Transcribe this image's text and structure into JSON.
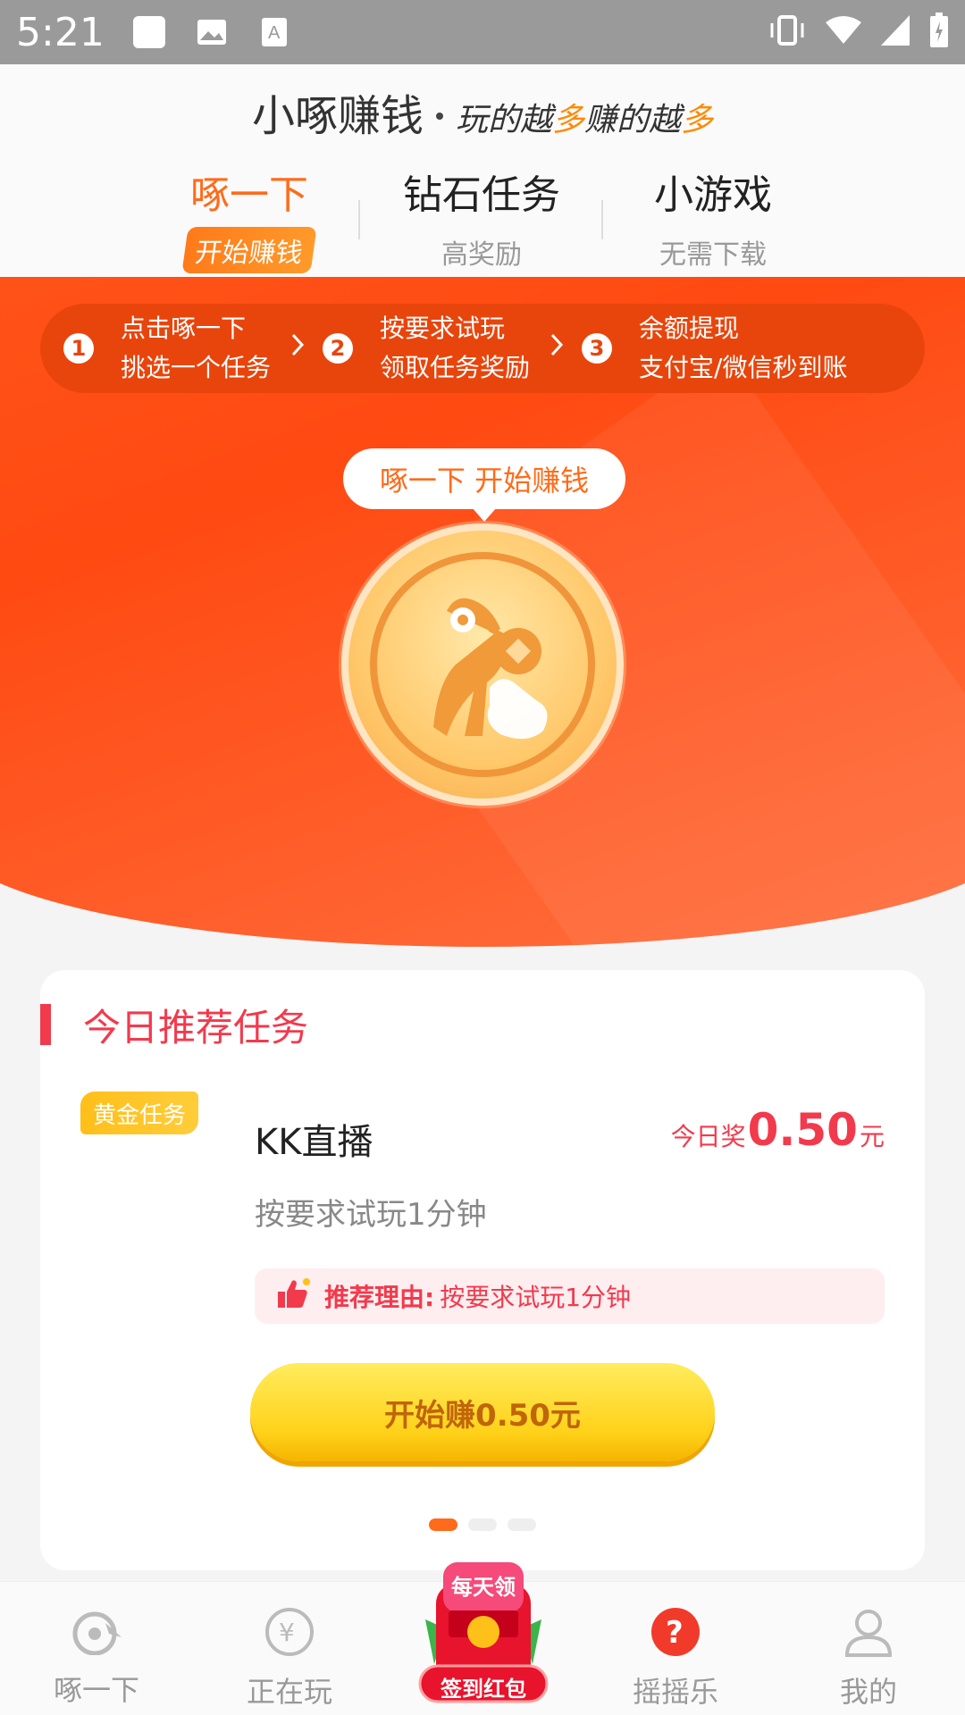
{
  "status_bar": {
    "time": "5:21",
    "left_icons": [
      "square-notification-icon",
      "image-icon",
      "text-a-icon"
    ],
    "right_icons": [
      "vibrate-icon",
      "wifi-icon",
      "signal-icon",
      "battery-icon"
    ]
  },
  "header": {
    "brand_name": "小啄赚钱",
    "slogan_parts": [
      "玩的越",
      "多",
      "赚的越",
      "多"
    ]
  },
  "tabs": [
    {
      "label": "啄一下",
      "sub": "开始赚钱",
      "active": true
    },
    {
      "label": "钻石任务",
      "sub": "高奖励",
      "active": false
    },
    {
      "label": "小游戏",
      "sub": "无需下载",
      "active": false
    }
  ],
  "steps": [
    {
      "num": "1",
      "line1": "点击啄一下",
      "line2": "挑选一个任务"
    },
    {
      "num": "2",
      "line1": "按要求试玩",
      "line2": "领取任务奖励"
    },
    {
      "num": "3",
      "line1": "余额提现",
      "line2": "支付宝/微信秒到账"
    }
  ],
  "hero": {
    "bubble_text": "啄一下  开始赚钱"
  },
  "recommend": {
    "section_title": "今日推荐任务",
    "badge": "黄金任务",
    "task_name": "KK直播",
    "reward_prefix": "今日奖",
    "reward_amount": "0.50",
    "reward_unit": "元",
    "desc": "按要求试玩1分钟",
    "reason_label": "推荐理由:",
    "reason_text": "按要求试玩1分钟",
    "button_label": "开始赚0.50元",
    "pager_count": 3,
    "pager_active": 0
  },
  "bottom_nav": {
    "items": [
      {
        "label": "啄一下",
        "icon": "bird-icon"
      },
      {
        "label": "正在玩",
        "icon": "yen-circle-icon"
      },
      {
        "label": "",
        "icon": "red-packet-icon"
      },
      {
        "label": "摇摇乐",
        "icon": "question-icon"
      },
      {
        "label": "我的",
        "icon": "user-icon"
      }
    ],
    "center_top": "每天领",
    "center_bottom": "签到红包"
  },
  "colors": {
    "accent": "#ff6b1a",
    "hero_red": "#ff4a12",
    "title_red": "#f23a4d",
    "gold": "#ffd21a"
  }
}
